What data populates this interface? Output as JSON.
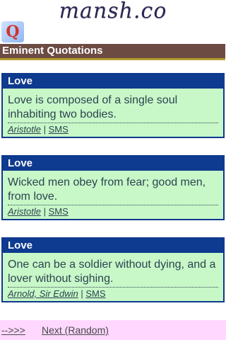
{
  "site": {
    "logo": "mansh.co",
    "icon_glyph": "Q"
  },
  "section": {
    "title": "Eminent Quotations"
  },
  "quotes": [
    {
      "topic": "Love",
      "text": "Love is composed of a single soul inhabiting two bodies.",
      "author": "Aristotle",
      "separator": "|",
      "sms": "SMS"
    },
    {
      "topic": "Love",
      "text": "Wicked men obey from fear; good men, from love.",
      "author": "Aristotle",
      "separator": "|",
      "sms": "SMS"
    },
    {
      "topic": "Love",
      "text": "One can be a soldier without dying, and a lover without sighing.",
      "author": "Arnold, Sir Edwin",
      "separator": "|",
      "sms": "SMS"
    }
  ],
  "footer": {
    "arrow_link": "-->>>",
    "next_link": "Next (Random)"
  },
  "colors": {
    "card_header": "#0e3a8f",
    "card_bg": "#c8f7c8",
    "section_bar": "#6c4b43",
    "footer_bg": "#ffd7ff"
  }
}
